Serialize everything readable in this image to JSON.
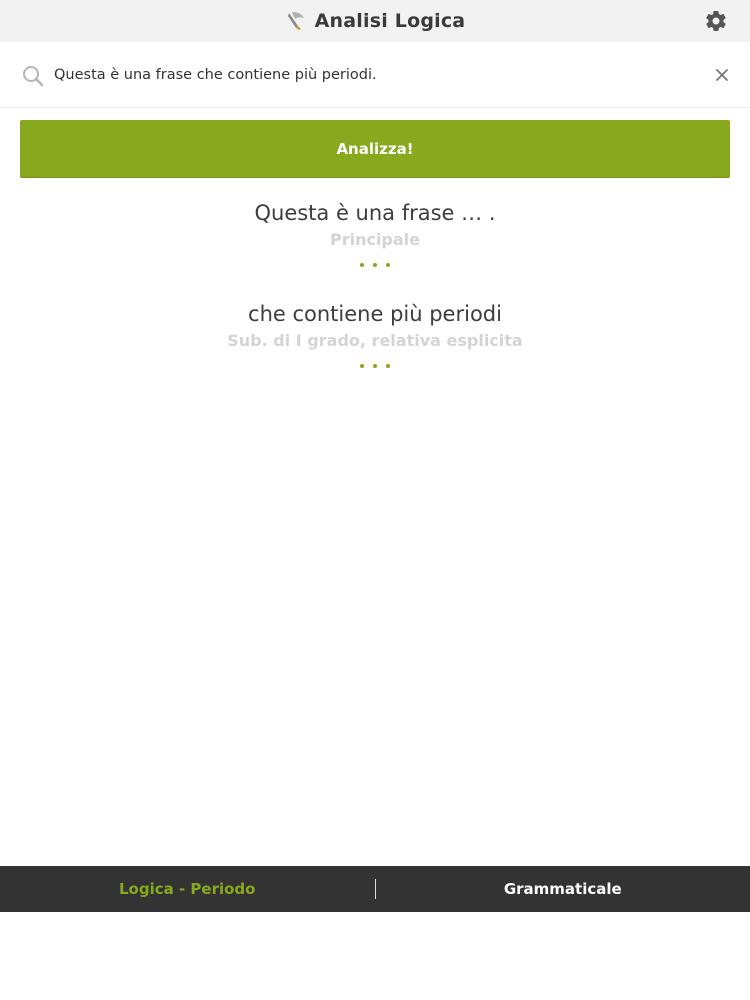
{
  "header": {
    "title": "Analisi Logica",
    "app_icon": "quill-icon",
    "settings_icon": "gear-icon"
  },
  "search": {
    "value": "Questa è una frase che contiene più periodi.",
    "search_icon": "search-icon",
    "clear_icon": "close-icon"
  },
  "actions": {
    "analyze_label": "Analizza!"
  },
  "results": [
    {
      "text": "Questa è una frase … .",
      "type": "Principale"
    },
    {
      "text": "che contiene più periodi",
      "type": "Sub. di I grado, relativa esplicita"
    }
  ],
  "tabs": [
    {
      "label": "Logica - Periodo",
      "active": true
    },
    {
      "label": "Grammaticale",
      "active": false
    }
  ],
  "colors": {
    "accent": "#88a81d",
    "header_bg": "#f2f2f2",
    "bottom_bar_bg": "#333333",
    "type_label": "#d4d4d4"
  }
}
